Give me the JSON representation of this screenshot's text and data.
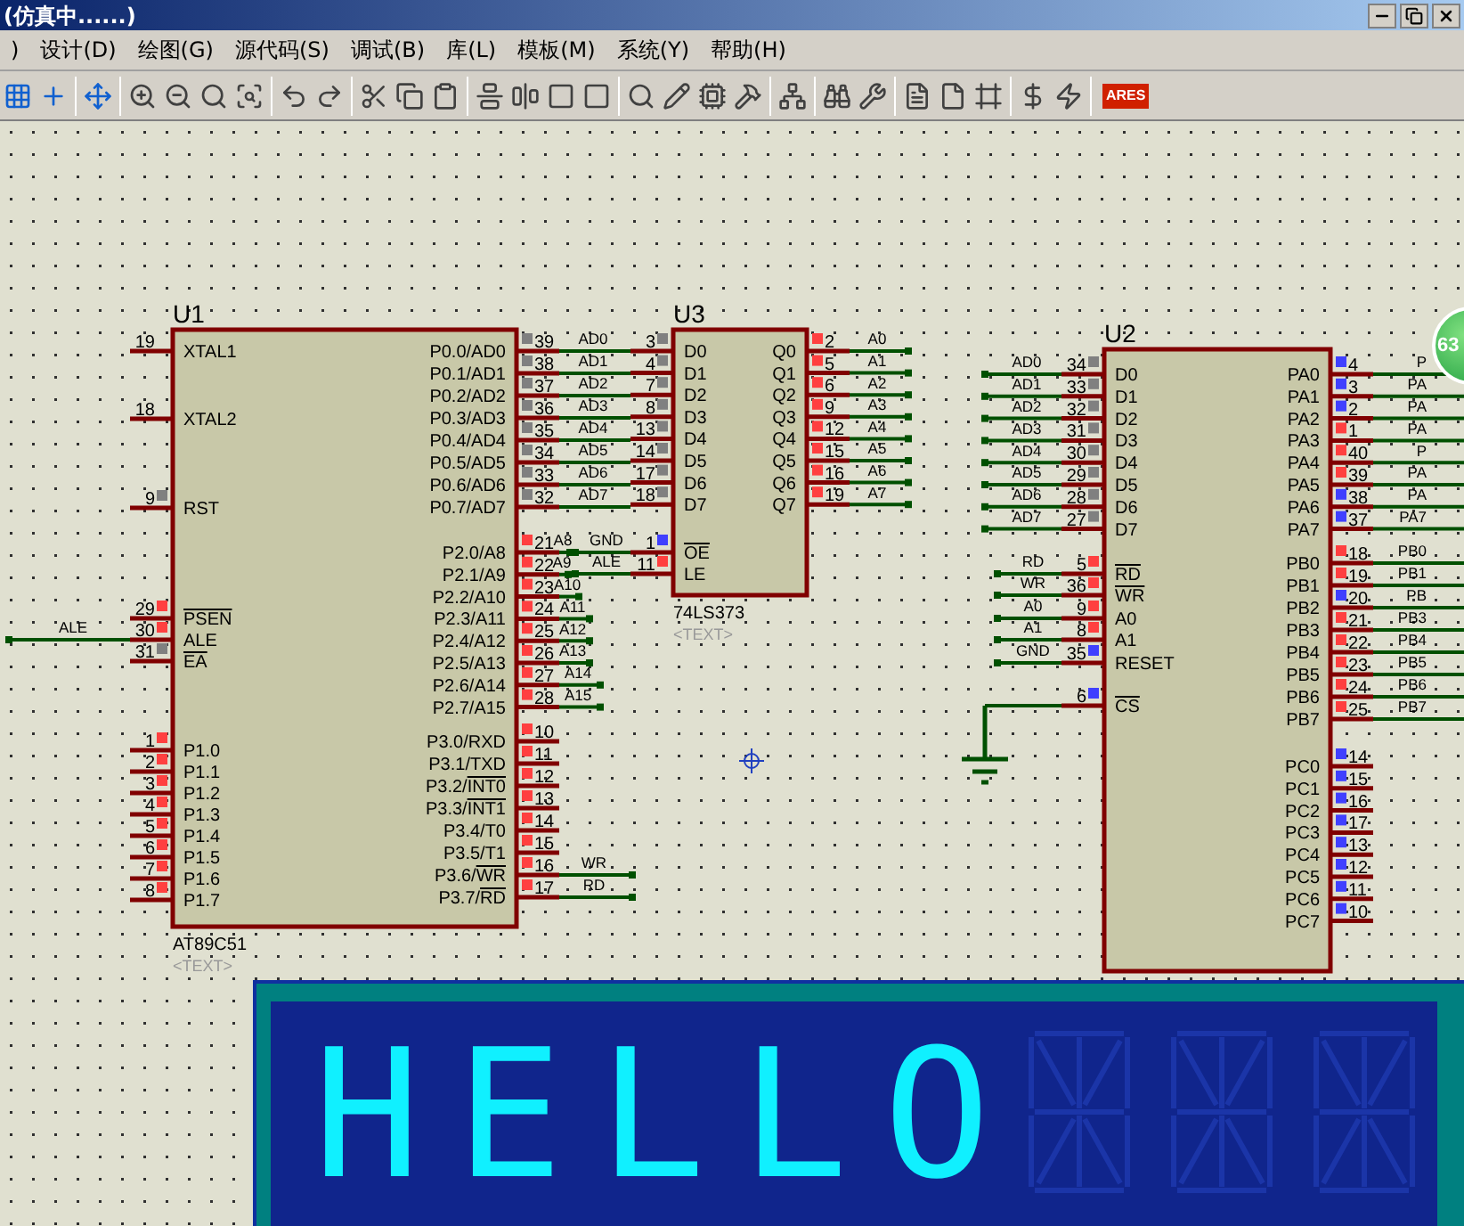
{
  "window": {
    "title": "(仿真中......)"
  },
  "menu": [
    {
      "label": ")"
    },
    {
      "label": "设计(D)"
    },
    {
      "label": "绘图(G)"
    },
    {
      "label": "源代码(S)"
    },
    {
      "label": "调试(B)"
    },
    {
      "label": "库(L)"
    },
    {
      "label": "模板(M)"
    },
    {
      "label": "系统(Y)"
    },
    {
      "label": "帮助(H)"
    }
  ],
  "toolbar": {
    "logo": "ARES"
  },
  "badge": {
    "text": "63"
  },
  "schematic": {
    "chips": [
      {
        "ref": "U1",
        "part": "AT89C51",
        "text": "<TEXT>",
        "left_pins": [
          {
            "num": "19",
            "name": "XTAL1"
          },
          {
            "num": "18",
            "name": "XTAL2"
          },
          {
            "num": "9",
            "name": "RST",
            "color": "#808080"
          },
          {
            "num": "29",
            "bar": "PSEN",
            "color": "#ff4040"
          },
          {
            "num": "30",
            "name": "ALE",
            "color": "#ff4040",
            "net": "ALE"
          },
          {
            "num": "31",
            "bar": "EA",
            "color": "#808080"
          },
          {
            "num": "1",
            "name": "P1.0",
            "color": "#ff4040"
          },
          {
            "num": "2",
            "name": "P1.1",
            "color": "#ff4040"
          },
          {
            "num": "3",
            "name": "P1.2",
            "color": "#ff4040"
          },
          {
            "num": "4",
            "name": "P1.3",
            "color": "#ff4040"
          },
          {
            "num": "5",
            "name": "P1.4",
            "color": "#ff4040"
          },
          {
            "num": "6",
            "name": "P1.5",
            "color": "#ff4040"
          },
          {
            "num": "7",
            "name": "P1.6",
            "color": "#ff4040"
          },
          {
            "num": "8",
            "name": "P1.7",
            "color": "#ff4040"
          }
        ],
        "right_pins": [
          {
            "num": "39",
            "name": "P0.0/AD0",
            "color": "#808080",
            "net": "AD0"
          },
          {
            "num": "38",
            "name": "P0.1/AD1",
            "color": "#808080",
            "net": "AD1"
          },
          {
            "num": "37",
            "name": "P0.2/AD2",
            "color": "#808080",
            "net": "AD2"
          },
          {
            "num": "36",
            "name": "P0.3/AD3",
            "color": "#808080",
            "net": "AD3"
          },
          {
            "num": "35",
            "name": "P0.4/AD4",
            "color": "#808080",
            "net": "AD4"
          },
          {
            "num": "34",
            "name": "P0.5/AD5",
            "color": "#808080",
            "net": "AD5"
          },
          {
            "num": "33",
            "name": "P0.6/AD6",
            "color": "#808080",
            "net": "AD6"
          },
          {
            "num": "32",
            "name": "P0.7/AD7",
            "color": "#808080",
            "net": "AD7"
          },
          {
            "num": "21",
            "name": "P2.0/A8",
            "color": "#ff4040",
            "net": "A8"
          },
          {
            "num": "22",
            "name": "P2.1/A9",
            "color": "#ff4040",
            "net": "A9"
          },
          {
            "num": "23",
            "name": "P2.2/A10",
            "color": "#ff4040",
            "net": "A10"
          },
          {
            "num": "24",
            "name": "P2.3/A11",
            "color": "#ff4040",
            "net": "A11"
          },
          {
            "num": "25",
            "name": "P2.4/A12",
            "color": "#ff4040",
            "net": "A12"
          },
          {
            "num": "26",
            "name": "P2.5/A13",
            "color": "#ff4040",
            "net": "A13"
          },
          {
            "num": "27",
            "name": "P2.6/A14",
            "color": "#ff4040",
            "net": "A14"
          },
          {
            "num": "28",
            "name": "P2.7/A15",
            "color": "#ff4040",
            "net": "A15"
          },
          {
            "num": "10",
            "name": "P3.0/RXD",
            "color": "#ff4040"
          },
          {
            "num": "11",
            "name": "P3.1/TXD",
            "color": "#ff4040"
          },
          {
            "num": "12",
            "name": "P3.2/",
            "bar": "INT0",
            "color": "#ff4040"
          },
          {
            "num": "13",
            "name": "P3.3/",
            "bar": "INT1",
            "color": "#ff4040"
          },
          {
            "num": "14",
            "name": "P3.4/T0",
            "color": "#ff4040"
          },
          {
            "num": "15",
            "name": "P3.5/T1",
            "color": "#ff4040"
          },
          {
            "num": "16",
            "name": "P3.6/",
            "bar": "WR",
            "color": "#ff4040",
            "net": "WR"
          },
          {
            "num": "17",
            "name": "P3.7/",
            "bar": "RD",
            "color": "#ff4040",
            "net": "RD"
          }
        ]
      },
      {
        "ref": "U3",
        "part": "74LS373",
        "text": "<TEXT>",
        "left_pins": [
          {
            "num": "3",
            "name": "D0",
            "color": "#808080"
          },
          {
            "num": "4",
            "name": "D1",
            "color": "#808080"
          },
          {
            "num": "7",
            "name": "D2",
            "color": "#808080"
          },
          {
            "num": "8",
            "name": "D3",
            "color": "#808080"
          },
          {
            "num": "13",
            "name": "D4",
            "color": "#808080"
          },
          {
            "num": "14",
            "name": "D5",
            "color": "#808080"
          },
          {
            "num": "17",
            "name": "D6",
            "color": "#808080"
          },
          {
            "num": "18",
            "name": "D7",
            "color": "#808080"
          },
          {
            "num": "1",
            "bar": "OE",
            "color": "#4040ff",
            "net": "GND"
          },
          {
            "num": "11",
            "name": "LE",
            "color": "#ff4040",
            "net": "ALE"
          }
        ],
        "right_pins": [
          {
            "num": "2",
            "name": "Q0",
            "color": "#ff4040",
            "net": "A0"
          },
          {
            "num": "5",
            "name": "Q1",
            "color": "#ff4040",
            "net": "A1"
          },
          {
            "num": "6",
            "name": "Q2",
            "color": "#ff4040",
            "net": "A2"
          },
          {
            "num": "9",
            "name": "Q3",
            "color": "#ff4040",
            "net": "A3"
          },
          {
            "num": "12",
            "name": "Q4",
            "color": "#ff4040",
            "net": "A4"
          },
          {
            "num": "15",
            "name": "Q5",
            "color": "#ff4040",
            "net": "A5"
          },
          {
            "num": "16",
            "name": "Q6",
            "color": "#ff4040",
            "net": "A6"
          },
          {
            "num": "19",
            "name": "Q7",
            "color": "#ff4040",
            "net": "A7"
          }
        ]
      },
      {
        "ref": "U2",
        "left_pins": [
          {
            "num": "34",
            "name": "D0",
            "color": "#808080",
            "net": "AD0"
          },
          {
            "num": "33",
            "name": "D1",
            "color": "#808080",
            "net": "AD1"
          },
          {
            "num": "32",
            "name": "D2",
            "color": "#808080",
            "net": "AD2"
          },
          {
            "num": "31",
            "name": "D3",
            "color": "#808080",
            "net": "AD3"
          },
          {
            "num": "30",
            "name": "D4",
            "color": "#808080",
            "net": "AD4"
          },
          {
            "num": "29",
            "name": "D5",
            "color": "#808080",
            "net": "AD5"
          },
          {
            "num": "28",
            "name": "D6",
            "color": "#808080",
            "net": "AD6"
          },
          {
            "num": "27",
            "name": "D7",
            "color": "#808080",
            "net": "AD7"
          },
          {
            "num": "5",
            "bar": "RD",
            "color": "#ff4040",
            "net": "RD"
          },
          {
            "num": "36",
            "bar": "WR",
            "color": "#ff4040",
            "net": "WR"
          },
          {
            "num": "9",
            "name": "A0",
            "color": "#ff4040",
            "net": "A0"
          },
          {
            "num": "8",
            "name": "A1",
            "color": "#ff4040",
            "net": "A1"
          },
          {
            "num": "35",
            "name": "RESET",
            "color": "#4040ff",
            "net": "GND"
          },
          {
            "num": "6",
            "bar": "CS",
            "color": "#4040ff"
          }
        ],
        "right_pins": [
          {
            "num": "4",
            "name": "PA0",
            "color": "#4040ff",
            "net": "P"
          },
          {
            "num": "3",
            "name": "PA1",
            "color": "#4040ff",
            "net": "PA"
          },
          {
            "num": "2",
            "name": "PA2",
            "color": "#4040ff",
            "net": "PA"
          },
          {
            "num": "1",
            "name": "PA3",
            "color": "#ff4040",
            "net": "PA"
          },
          {
            "num": "40",
            "name": "PA4",
            "color": "#ff4040",
            "net": "P"
          },
          {
            "num": "39",
            "name": "PA5",
            "color": "#ff4040",
            "net": "PA"
          },
          {
            "num": "38",
            "name": "PA6",
            "color": "#4040ff",
            "net": "PA"
          },
          {
            "num": "37",
            "name": "PA7",
            "color": "#4040ff",
            "net": "PA7"
          },
          {
            "num": "18",
            "name": "PB0",
            "color": "#ff4040",
            "net": "PB0"
          },
          {
            "num": "19",
            "name": "PB1",
            "color": "#ff4040",
            "net": "PB1"
          },
          {
            "num": "20",
            "name": "PB2",
            "color": "#4040ff",
            "net": "PB"
          },
          {
            "num": "21",
            "name": "PB3",
            "color": "#ff4040",
            "net": "PB3"
          },
          {
            "num": "22",
            "name": "PB4",
            "color": "#ff4040",
            "net": "PB4"
          },
          {
            "num": "23",
            "name": "PB5",
            "color": "#ff4040",
            "net": "PB5"
          },
          {
            "num": "24",
            "name": "PB6",
            "color": "#ff4040",
            "net": "PB6"
          },
          {
            "num": "25",
            "name": "PB7",
            "color": "#ff4040",
            "net": "PB7"
          },
          {
            "num": "14",
            "name": "PC0",
            "color": "#4040ff"
          },
          {
            "num": "15",
            "name": "PC1",
            "color": "#4040ff"
          },
          {
            "num": "16",
            "name": "PC2",
            "color": "#4040ff"
          },
          {
            "num": "17",
            "name": "PC3",
            "color": "#4040ff"
          },
          {
            "num": "13",
            "name": "PC4",
            "color": "#4040ff"
          },
          {
            "num": "12",
            "name": "PC5",
            "color": "#4040ff"
          },
          {
            "num": "11",
            "name": "PC6",
            "color": "#4040ff"
          },
          {
            "num": "10",
            "name": "PC7",
            "color": "#4040ff"
          }
        ]
      }
    ]
  },
  "display": {
    "digits": [
      {
        "char": "H",
        "lit": true
      },
      {
        "char": "E",
        "lit": true
      },
      {
        "char": "L",
        "lit": true
      },
      {
        "char": "L",
        "lit": true
      },
      {
        "char": "O",
        "lit": true
      },
      {
        "lit": false
      },
      {
        "lit": false
      },
      {
        "lit": false
      }
    ]
  }
}
